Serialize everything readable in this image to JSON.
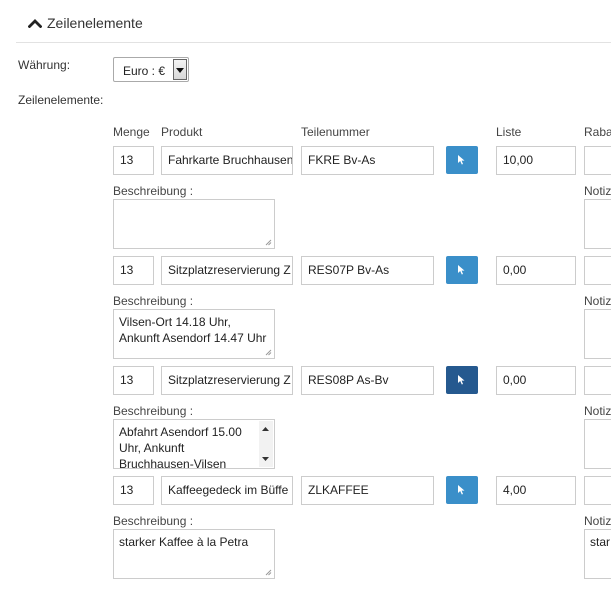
{
  "section": {
    "title": "Zeilenelemente"
  },
  "currency": {
    "label": "Währung:",
    "value": "Euro : €"
  },
  "line_items_label": "Zeilenelemente:",
  "columns": {
    "qty": "Menge",
    "product": "Produkt",
    "part_no": "Teilenummer",
    "list": "Liste",
    "discount": "Raba"
  },
  "description_label": "Beschreibung :",
  "note_label": "Notiz",
  "rows": [
    {
      "qty": "13",
      "product": "Fahrkarte Bruchhausen",
      "part_no": "FKRE Bv-As",
      "list": "10,00",
      "description": "",
      "note": ""
    },
    {
      "qty": "13",
      "product": "Sitzplatzreservierung Z",
      "part_no": "RES07P Bv-As",
      "list": "0,00",
      "description": "Vilsen-Ort 14.18 Uhr, Ankunft Asendorf 14.47 Uhr",
      "note": ""
    },
    {
      "qty": "13",
      "product": "Sitzplatzreservierung Z",
      "part_no": "RES08P As-Bv",
      "list": "0,00",
      "description": "Abfahrt Asendorf 15.00 Uhr, Ankunft Bruchhausen-Vilsen",
      "note": ""
    },
    {
      "qty": "13",
      "product": "Kaffeegedeck im Büffe",
      "part_no": "ZLKAFFEE",
      "list": "4,00",
      "description": "starker Kaffee à la Petra",
      "note": "star"
    }
  ],
  "icons": {
    "section_toggle": "chevron-up-icon",
    "picker": "cursor-arrow-icon",
    "resize": "resize-grip-icon"
  },
  "colors": {
    "picker": "#3a8fc9",
    "picker_active": "#25598f"
  }
}
